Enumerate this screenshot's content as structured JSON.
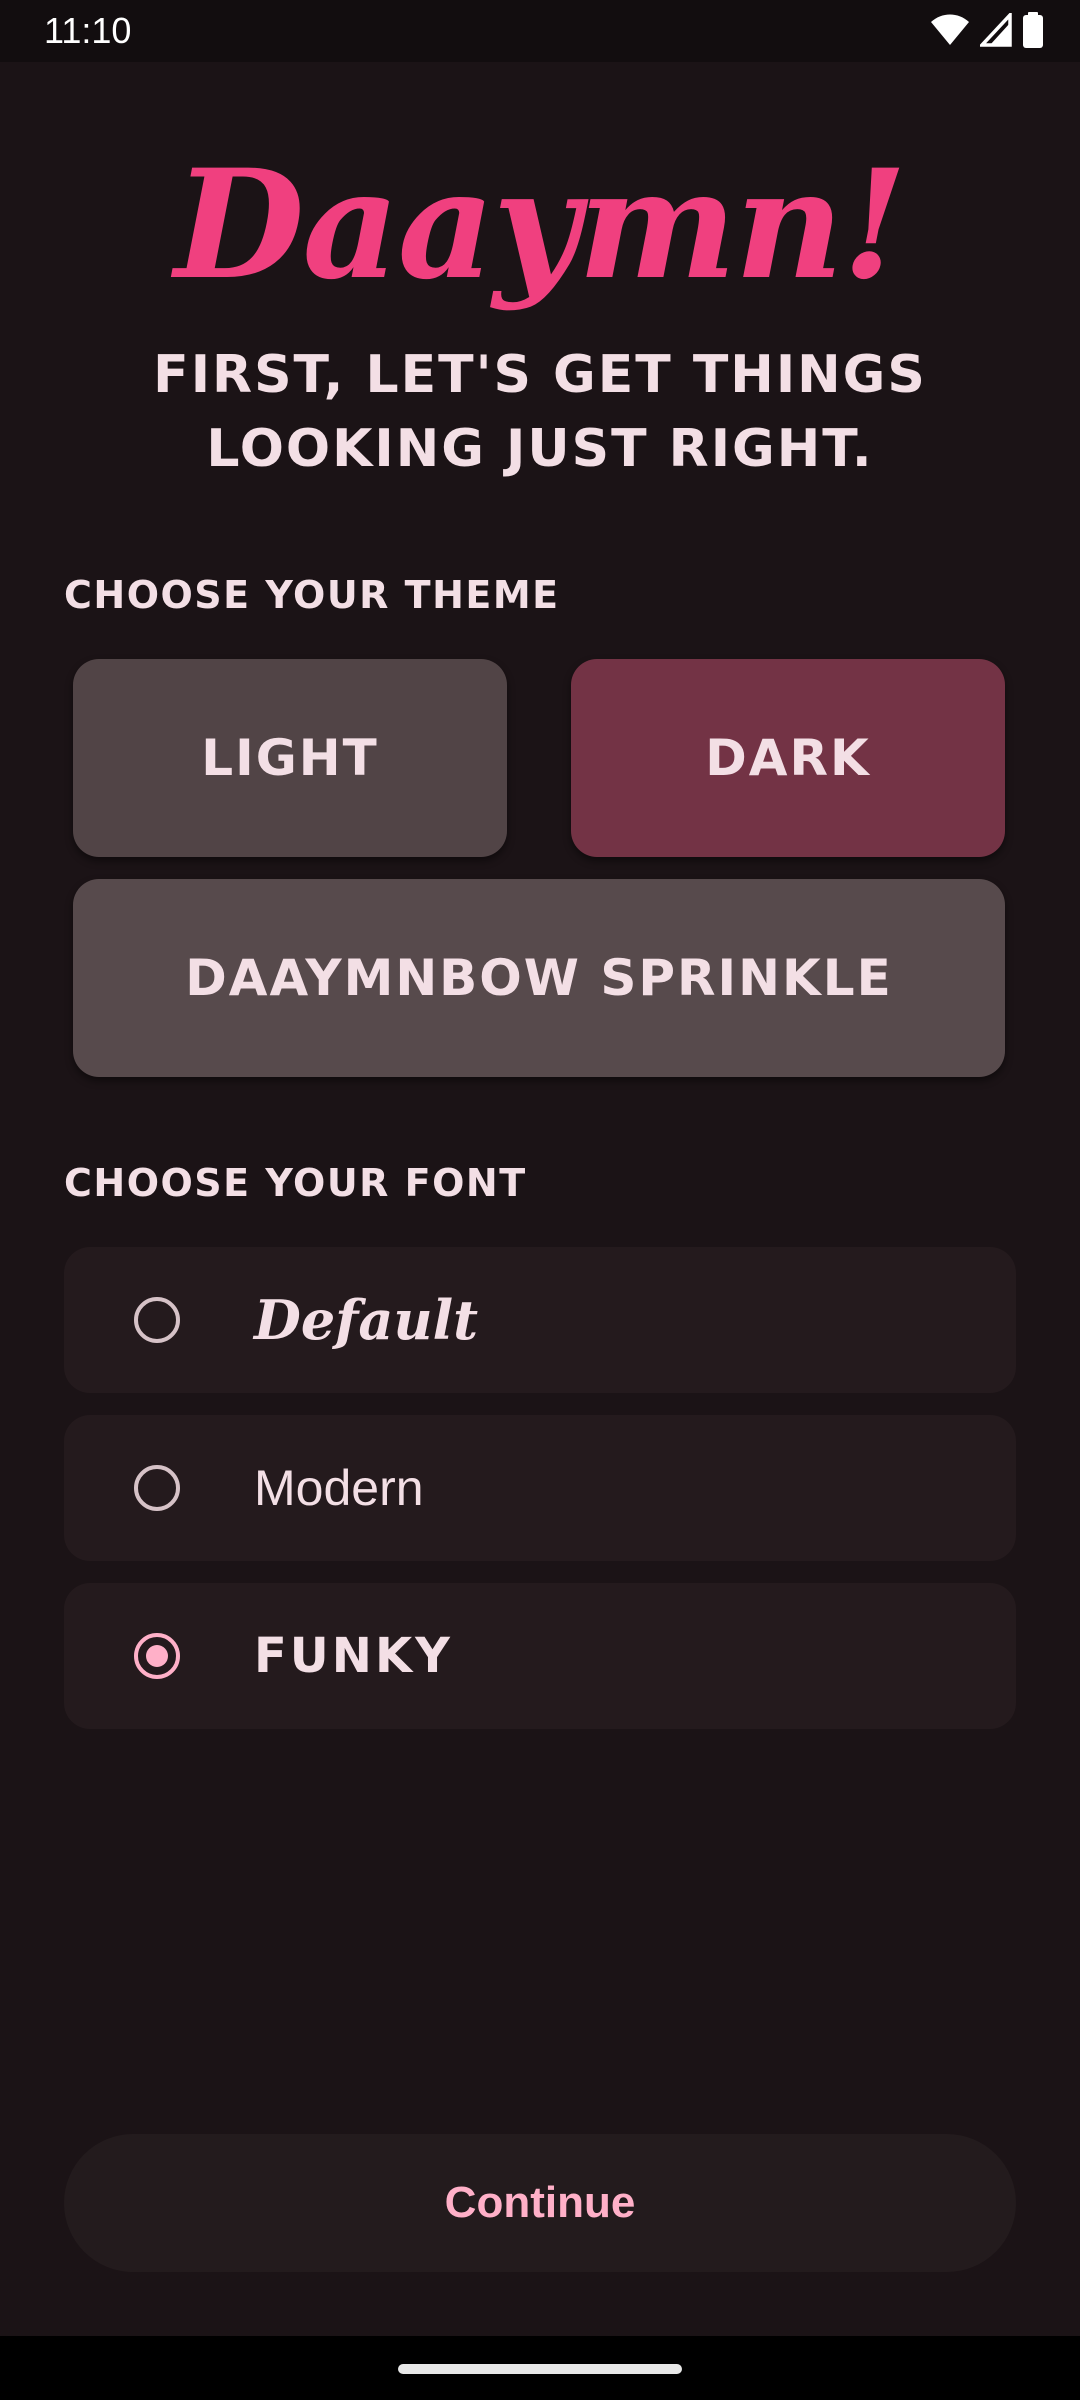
{
  "status_bar": {
    "time": "11:10",
    "icons": [
      "wifi-icon",
      "signal-icon",
      "battery-icon"
    ]
  },
  "header": {
    "logo": "Daaymn!",
    "subtitle": "FIRST, LET'S GET THINGS LOOKING JUST RIGHT."
  },
  "theme": {
    "label": "CHOOSE YOUR THEME",
    "options": [
      {
        "label": "LIGHT",
        "selected": false
      },
      {
        "label": "DARK",
        "selected": true
      },
      {
        "label": "DAAYMNBOW SPRINKLE",
        "selected": false
      }
    ]
  },
  "font": {
    "label": "CHOOSE YOUR FONT",
    "options": [
      {
        "label": "Default",
        "selected": false
      },
      {
        "label": "Modern",
        "selected": false
      },
      {
        "label": "FUNKY",
        "selected": true
      }
    ]
  },
  "footer": {
    "continue_label": "Continue"
  },
  "colors": {
    "background": "#1b1316",
    "accent_pink": "#f0407f",
    "selected_theme": "#733345",
    "radio_selected": "#ffb0c8",
    "text": "#f3dfe5"
  }
}
